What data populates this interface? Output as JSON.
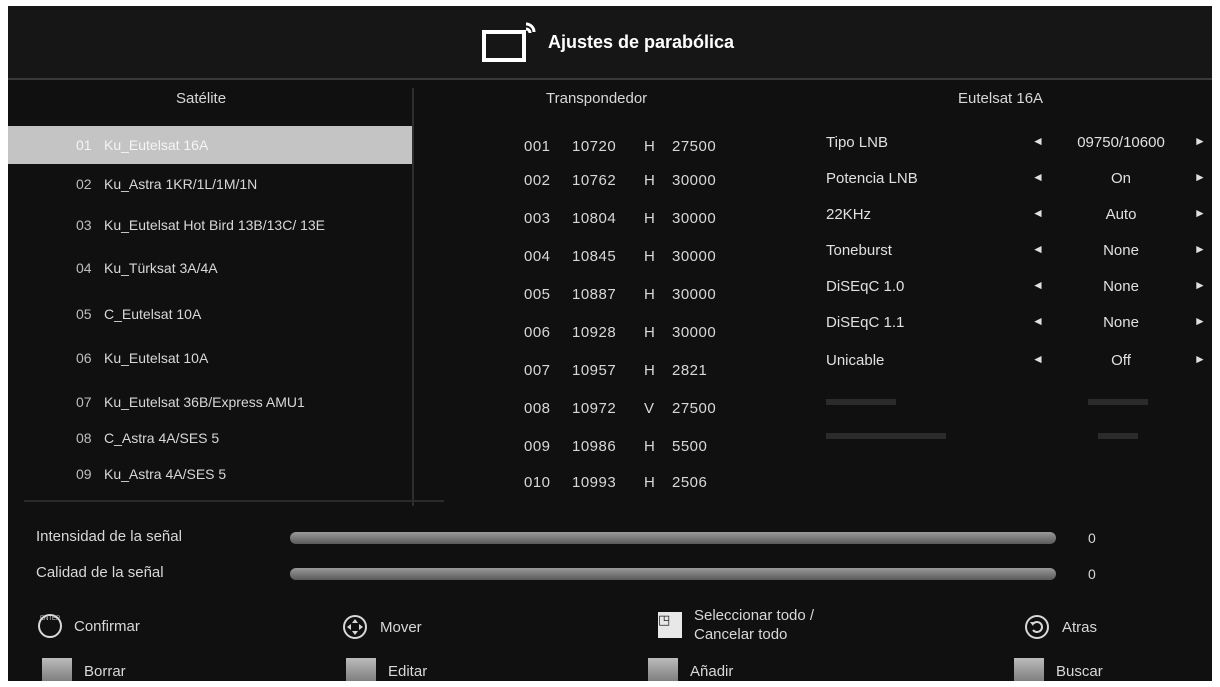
{
  "header": {
    "title": "Ajustes de parabólica",
    "icon": "satellite-dish-tv-icon"
  },
  "columns": {
    "satellite": "Satélite",
    "transponder": "Transpondedor",
    "settings": "Eutelsat 16A"
  },
  "satellites": [
    {
      "num": "01",
      "name": "Ku_Eutelsat 16A",
      "selected": true
    },
    {
      "num": "02",
      "name": "Ku_Astra 1KR/1L/1M/1N"
    },
    {
      "num": "03",
      "name": "Ku_Eutelsat Hot Bird 13B/13C/ 13E"
    },
    {
      "num": "04",
      "name": "Ku_Türksat 3A/4A"
    },
    {
      "num": "05",
      "name": "C_Eutelsat 10A"
    },
    {
      "num": "06",
      "name": "Ku_Eutelsat 10A"
    },
    {
      "num": "07",
      "name": "Ku_Eutelsat 36B/Express AMU1"
    },
    {
      "num": "08",
      "name": "C_Astra 4A/SES 5"
    },
    {
      "num": "09",
      "name": "Ku_Astra 4A/SES 5"
    }
  ],
  "transponders": [
    {
      "num": "001",
      "freq": "10720",
      "pol": "H",
      "sr": "27500"
    },
    {
      "num": "002",
      "freq": "10762",
      "pol": "H",
      "sr": "30000"
    },
    {
      "num": "003",
      "freq": "10804",
      "pol": "H",
      "sr": "30000"
    },
    {
      "num": "004",
      "freq": "10845",
      "pol": "H",
      "sr": "30000"
    },
    {
      "num": "005",
      "freq": "10887",
      "pol": "H",
      "sr": "30000"
    },
    {
      "num": "006",
      "freq": "10928",
      "pol": "H",
      "sr": "30000"
    },
    {
      "num": "007",
      "freq": "10957",
      "pol": "H",
      "sr": "2821"
    },
    {
      "num": "008",
      "freq": "10972",
      "pol": "V",
      "sr": "27500"
    },
    {
      "num": "009",
      "freq": "10986",
      "pol": "H",
      "sr": "5500"
    },
    {
      "num": "010",
      "freq": "10993",
      "pol": "H",
      "sr": "2506"
    }
  ],
  "settings": [
    {
      "label": "Tipo LNB",
      "value": "09750/10600"
    },
    {
      "label": "Potencia LNB",
      "value": "On"
    },
    {
      "label": "22KHz",
      "value": "Auto"
    },
    {
      "label": "Toneburst",
      "value": "None"
    },
    {
      "label": "DiSEqC 1.0",
      "value": "None"
    },
    {
      "label": "DiSEqC 1.1",
      "value": "None"
    },
    {
      "label": "Unicable",
      "value": "Off"
    }
  ],
  "signal": {
    "strength_label": "Intensidad de la señal",
    "strength_value": "0",
    "strength_fraction": 0,
    "quality_label": "Calidad de la señal",
    "quality_value": "0",
    "quality_fraction": 0
  },
  "help": {
    "confirm": "Confirmar",
    "move": "Mover",
    "select_all": "Seleccionar todo /",
    "cancel_all": "Cancelar todo",
    "back": "Atras",
    "delete": "Borrar",
    "edit": "Editar",
    "add": "Añadir",
    "search": "Buscar",
    "enter_icon_text": "ENTER"
  }
}
